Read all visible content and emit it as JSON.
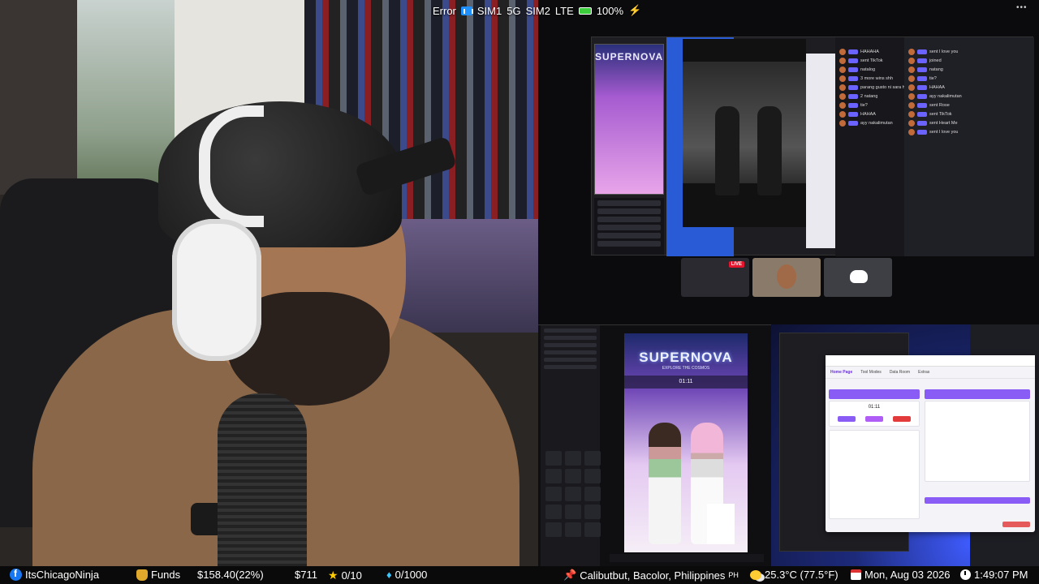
{
  "status_bar": {
    "error_label": "Error",
    "sim1_label": "SIM1",
    "sim1_network": "5G",
    "sim2_label": "SIM2",
    "sim2_network": "LTE",
    "battery_percent": "100%",
    "charging_icon": "bolt-icon",
    "menu_icon": "more-dots-icon"
  },
  "preview": {
    "phone_title": "SUPERNOVA",
    "live_badge": "LIVE",
    "chat_lines": [
      "HAHAHA",
      "sent TikTok",
      "natalog",
      "3 more wins shh",
      "parang gusto ni sara humabol score",
      "2 natang",
      "tie?",
      "HAHAA",
      "ayy nakalimutan"
    ],
    "chat_lines_right": [
      "sent I love you",
      "joined",
      "natang",
      "tie?",
      "HAHAA",
      "ayy nakalimutan",
      "sent Rose",
      "sent TikTok",
      "sent Heart Me",
      "sent I love you"
    ]
  },
  "obs": {
    "title": "SUPERNOVA",
    "subtitle": "EXPLORE THE COSMOS",
    "timer": "01:11"
  },
  "desk_app": {
    "tabs": [
      "Home Page",
      "Tool Modes",
      "Data Room",
      "Extras"
    ],
    "timer": "01:11"
  },
  "ticker": {
    "channel": "ItsChicagoNinja",
    "funds_label": "Funds",
    "funds_value": "$158.40(22%)",
    "goal_value": "$711",
    "stars": "0/10",
    "gems": "0/1000",
    "location": "Calibutbut, Bacolor, Philippines",
    "location_suffix": "PH",
    "weather": "25.3°C (77.5°F)",
    "date": "Mon, Aug 03 2026",
    "time": "1:49:07 PM"
  },
  "colors": {
    "accent_purple": "#8a5cf6",
    "battery_green": "#3ccd3c",
    "live_red": "#e3162d",
    "facebook_blue": "#1877f2"
  }
}
